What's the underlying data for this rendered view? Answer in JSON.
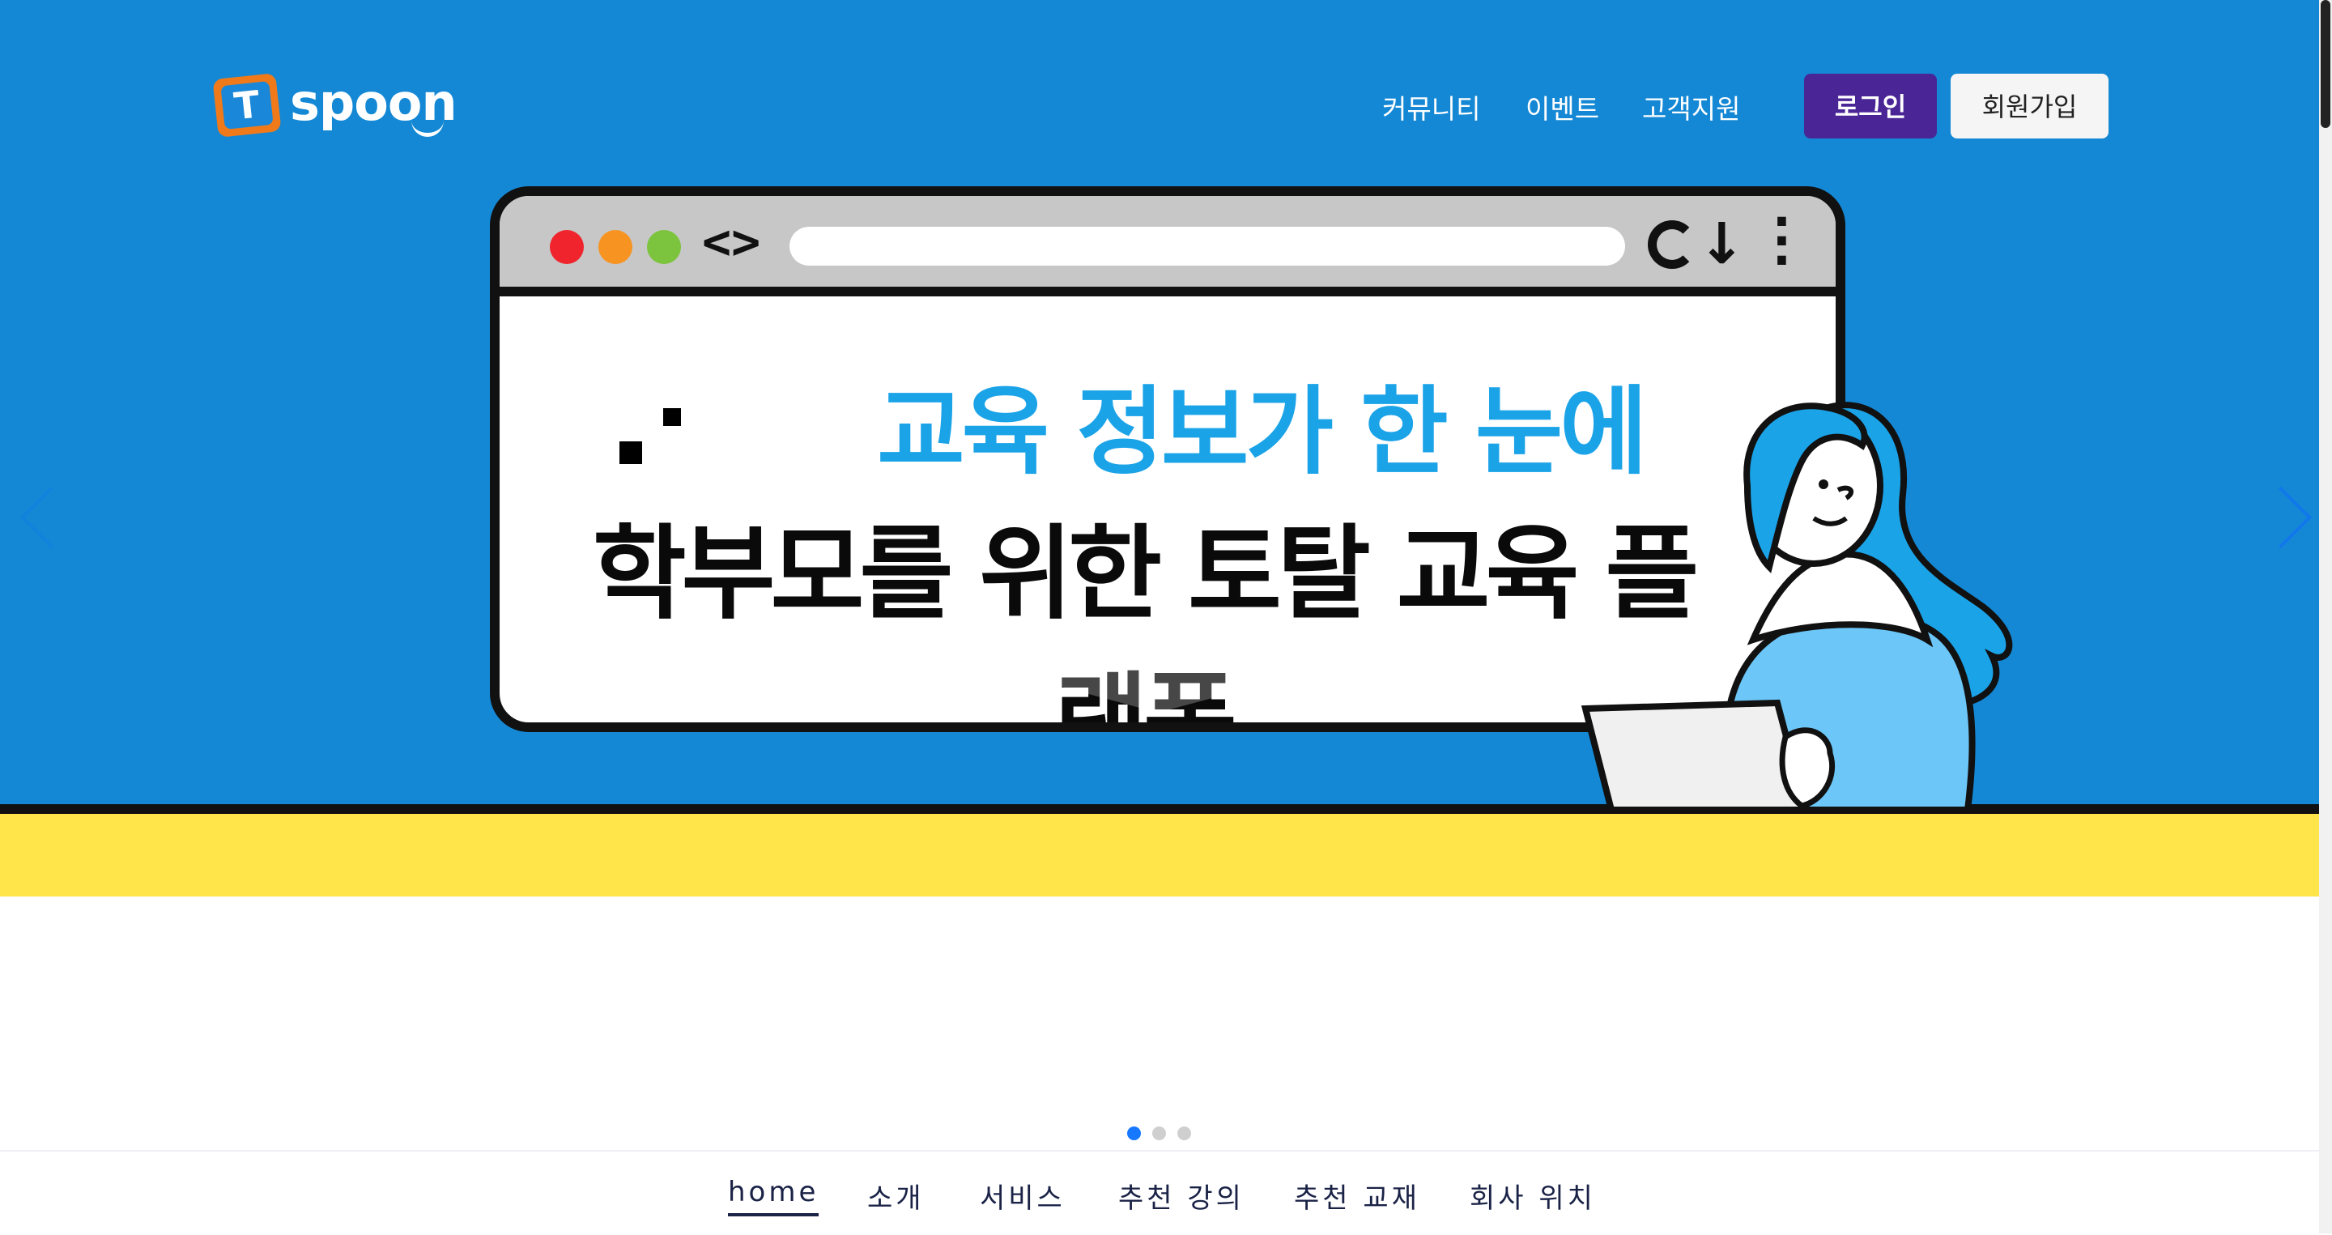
{
  "header": {
    "logo_letter": "T",
    "logo_text": "spoon",
    "nav": [
      "커뮤니티",
      "이벤트",
      "고객지원"
    ],
    "login_label": "로그인",
    "signup_label": "회원가입"
  },
  "hero": {
    "headline_top": "교육 정보가 한 눈에",
    "headline_main": "학부모를 위한 토탈 교육 플랫폼",
    "colors": {
      "background": "#1488d4",
      "floor": "#ffe54a",
      "headline_blue": "#1ba3e8",
      "login_button": "#4a2596"
    }
  },
  "carousel": {
    "slide_count": 3,
    "active_index": 0
  },
  "subnav": {
    "items": [
      "home",
      "소개",
      "서비스",
      "추천 강의",
      "추천 교재",
      "회사 위치"
    ],
    "active_index": 0
  },
  "icons": [
    "browser-close-dot",
    "browser-minimize-dot",
    "browser-maximize-dot",
    "code-icon",
    "reload-icon",
    "download-icon",
    "more-vertical-icon",
    "chevron-left-icon",
    "chevron-right-icon"
  ]
}
